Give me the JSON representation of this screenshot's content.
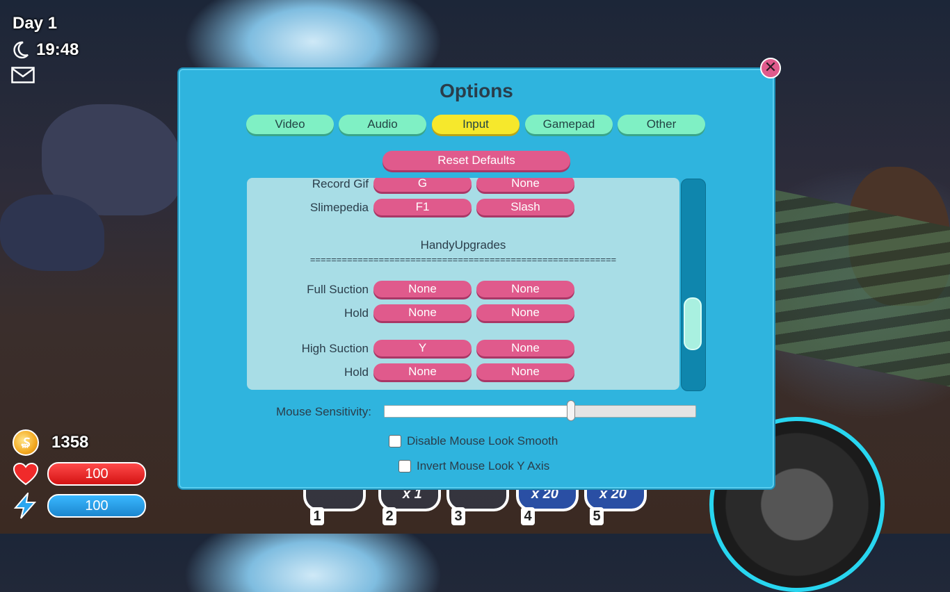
{
  "hud": {
    "day": "Day 1",
    "time": "19:48",
    "coins": "1358",
    "health": "100",
    "energy": "100",
    "health_fraction": 1.0,
    "energy_fraction": 1.0
  },
  "hotbar": {
    "slots": [
      {
        "number": "1",
        "qty": ""
      },
      {
        "number": "2",
        "qty": "x 1"
      },
      {
        "number": "3",
        "qty": ""
      },
      {
        "number": "4",
        "qty": "x 20"
      },
      {
        "number": "5",
        "qty": "x 20"
      }
    ]
  },
  "options": {
    "title": "Options",
    "tabs": [
      "Video",
      "Audio",
      "Input",
      "Gamepad",
      "Other"
    ],
    "active_tab": "Input",
    "reset_label": "Reset Defaults",
    "bindings": [
      {
        "label": "Record Gif",
        "primary": "G",
        "secondary": "None"
      },
      {
        "label": "Slimepedia",
        "primary": "F1",
        "secondary": "Slash"
      },
      {
        "label": "Full Suction",
        "primary": "None",
        "secondary": "None"
      },
      {
        "label": "Hold",
        "primary": "None",
        "secondary": "None"
      },
      {
        "label": "High Suction",
        "primary": "Y",
        "secondary": "None"
      },
      {
        "label": "Hold",
        "primary": "None",
        "secondary": "None"
      }
    ],
    "section_title": "HandyUpgrades",
    "section_separator": "==========================================================",
    "scroll_position": 0.75,
    "mouse_sensitivity_label": "Mouse Sensitivity:",
    "mouse_sensitivity_value": 0.6,
    "disable_smooth_label": "Disable Mouse Look Smooth",
    "disable_smooth_checked": false,
    "invert_y_label": "Invert Mouse Look Y Axis",
    "invert_y_checked": false
  },
  "colors": {
    "panel": "#2fb4de",
    "tab": "#7ff0c4",
    "tab_active": "#f6e82c",
    "key_button": "#e05a8c"
  },
  "icons": [
    "moon-icon",
    "mail-icon",
    "coin-icon",
    "heart-icon",
    "lightning-icon",
    "close-icon"
  ]
}
